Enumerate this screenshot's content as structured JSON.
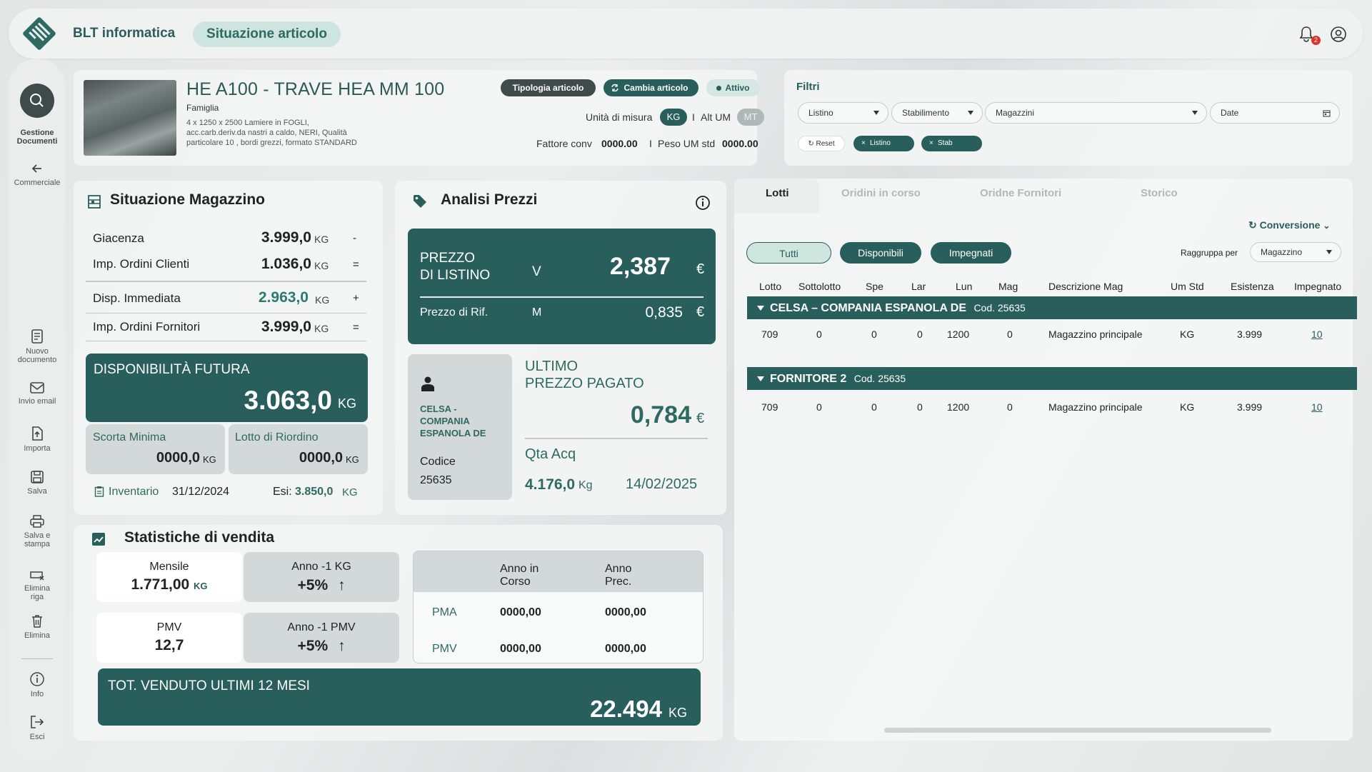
{
  "app": {
    "brand": "BLT informatica",
    "page_title": "Situazione articolo",
    "notification_count": "2"
  },
  "sidebar": {
    "items": [
      {
        "label": "Gestione Documenti",
        "icon": "search-icon"
      },
      {
        "label": "Commerciale",
        "icon": "arrow-left-icon"
      },
      {
        "label": "Nuovo documento",
        "icon": "new-document-icon"
      },
      {
        "label": "Invio email",
        "icon": "mail-icon"
      },
      {
        "label": "Importa",
        "icon": "import-icon"
      },
      {
        "label": "Salva",
        "icon": "save-icon"
      },
      {
        "label": "Salva e stampa",
        "icon": "print-icon"
      },
      {
        "label": "Elimina riga",
        "icon": "delete-row-icon"
      },
      {
        "label": "Elimina",
        "icon": "trash-icon"
      },
      {
        "label": "Info",
        "icon": "info-icon"
      },
      {
        "label": "Esci",
        "icon": "logout-icon"
      }
    ]
  },
  "article": {
    "title": "HE A100 - TRAVE HEA MM 100",
    "family_label": "Famiglia",
    "desc_line1": "4    x 1250 x 2500   Lamiere in FOGLI,",
    "desc_line2": "acc.carb.deriv.da nastri a caldo, NERI, Qualità",
    "desc_line3": "particolare 10 , bordi grezzi, formato STANDARD",
    "btn_tipologia": "Tipologia articolo",
    "btn_cambia": "Cambia articolo",
    "status": "Attivo",
    "um_label": "Unità di misura",
    "um_value": "KG",
    "sep": "I",
    "alt_um_label": "Alt UM",
    "alt_um_value": "MT",
    "fattore_label": "Fattore conv",
    "fattore_value": "0000.00",
    "peso_label": "Peso UM std",
    "peso_value": "0000.00"
  },
  "filters": {
    "title": "Filtri",
    "listino": "Listino",
    "stabilimento": "Stabilimento",
    "magazzini": "Magazzini",
    "date": "Date",
    "reset": "Reset",
    "tag1": "Listino",
    "tag2": "Stab"
  },
  "magazzino": {
    "title": "Situazione Magazzino",
    "rows": [
      {
        "label": "Giacenza",
        "value": "3.999,0",
        "unit": "KG",
        "op": "-"
      },
      {
        "label": "Imp. Ordini Clienti",
        "value": "1.036,0",
        "unit": "KG",
        "op": "="
      },
      {
        "label": "Disp. Immediata",
        "value": "2.963,0",
        "unit": "KG",
        "op": "+"
      },
      {
        "label": "Imp. Ordini Fornitori",
        "value": "3.999,0",
        "unit": "KG",
        "op": "="
      }
    ],
    "futura_label": "DISPONIBILITÀ FUTURA",
    "futura_value": "3.063,0",
    "futura_unit": "KG",
    "scorta_label": "Scorta Minima",
    "scorta_value": "0000,0",
    "scorta_unit": "KG",
    "lotto_label": "Lotto di Riordino",
    "lotto_value": "0000,0",
    "lotto_unit": "KG",
    "inventario_label": "Inventario",
    "inventario_date": "31/12/2024",
    "esi_label": "Esi:",
    "esi_value": "3.850,0",
    "esi_unit": "KG"
  },
  "prezzi": {
    "title": "Analisi Prezzi",
    "listino_label1": "PREZZO",
    "listino_label2": "DI LISTINO",
    "listino_code": "V",
    "listino_value": "2,387",
    "currency": "€",
    "rif_label": "Prezzo di Rif.",
    "rif_code": "M",
    "rif_value": "0,835",
    "fornitore_name": "CELSA - COMPANIA ESPANOLA DE",
    "codice_label": "Codice",
    "codice_value": "25635",
    "ultimo_label1": "ULTIMO",
    "ultimo_label2": "PREZZO PAGATO",
    "ultimo_value": "0,784",
    "qta_label": "Qta Acq",
    "qta_value": "4.176,0",
    "qta_unit": "Kg",
    "qta_date": "14/02/2025"
  },
  "lotti": {
    "tabs": [
      "Lotti",
      "Oridini in corso",
      "Oridne Fornitori",
      "Storico"
    ],
    "conversione": "Conversione",
    "filter_buttons": [
      "Tutti",
      "Disponibili",
      "Impegnati"
    ],
    "raggruppa_label": "Raggruppa per",
    "raggruppa_value": "Magazzino",
    "columns": [
      "Lotto",
      "Sottolotto",
      "Spe",
      "Lar",
      "Lun",
      "Mag",
      "Descrizione Mag",
      "Um Std",
      "Esistenza",
      "Impegnato"
    ],
    "groups": [
      {
        "name": "CELSA – COMPANIA ESPANOLA DE",
        "cod": "Cod. 25635",
        "rows": [
          [
            "709",
            "0",
            "0",
            "0",
            "1200",
            "0",
            "Magazzino principale",
            "KG",
            "3.999",
            "10"
          ]
        ]
      },
      {
        "name": "FORNITORE 2",
        "cod": "Cod. 25635",
        "rows": [
          [
            "709",
            "0",
            "0",
            "0",
            "1200",
            "0",
            "Magazzino principale",
            "KG",
            "3.999",
            "10"
          ]
        ]
      }
    ]
  },
  "statistiche": {
    "title": "Statistiche di vendita",
    "mensile_label": "Mensile",
    "mensile_value": "1.771,00",
    "mensile_unit": "KG",
    "anno1kg_label": "Anno -1 KG",
    "anno1kg_value": "+5%",
    "pmv_label": "PMV",
    "pmv_value": "12,7",
    "anno1pmv_label": "Anno -1 PMV",
    "anno1pmv_value": "+5%",
    "table_headers": [
      "Anno in Corso",
      "Anno Prec."
    ],
    "table_rows": [
      {
        "label": "PMA",
        "v1": "0000,00",
        "v2": "0000,00"
      },
      {
        "label": "PMV",
        "v1": "0000,00",
        "v2": "0000,00"
      }
    ],
    "tot_label": "TOT. VENDUTO ULTIMI 12 MESI",
    "tot_value": "22.494",
    "tot_unit": "KG"
  }
}
